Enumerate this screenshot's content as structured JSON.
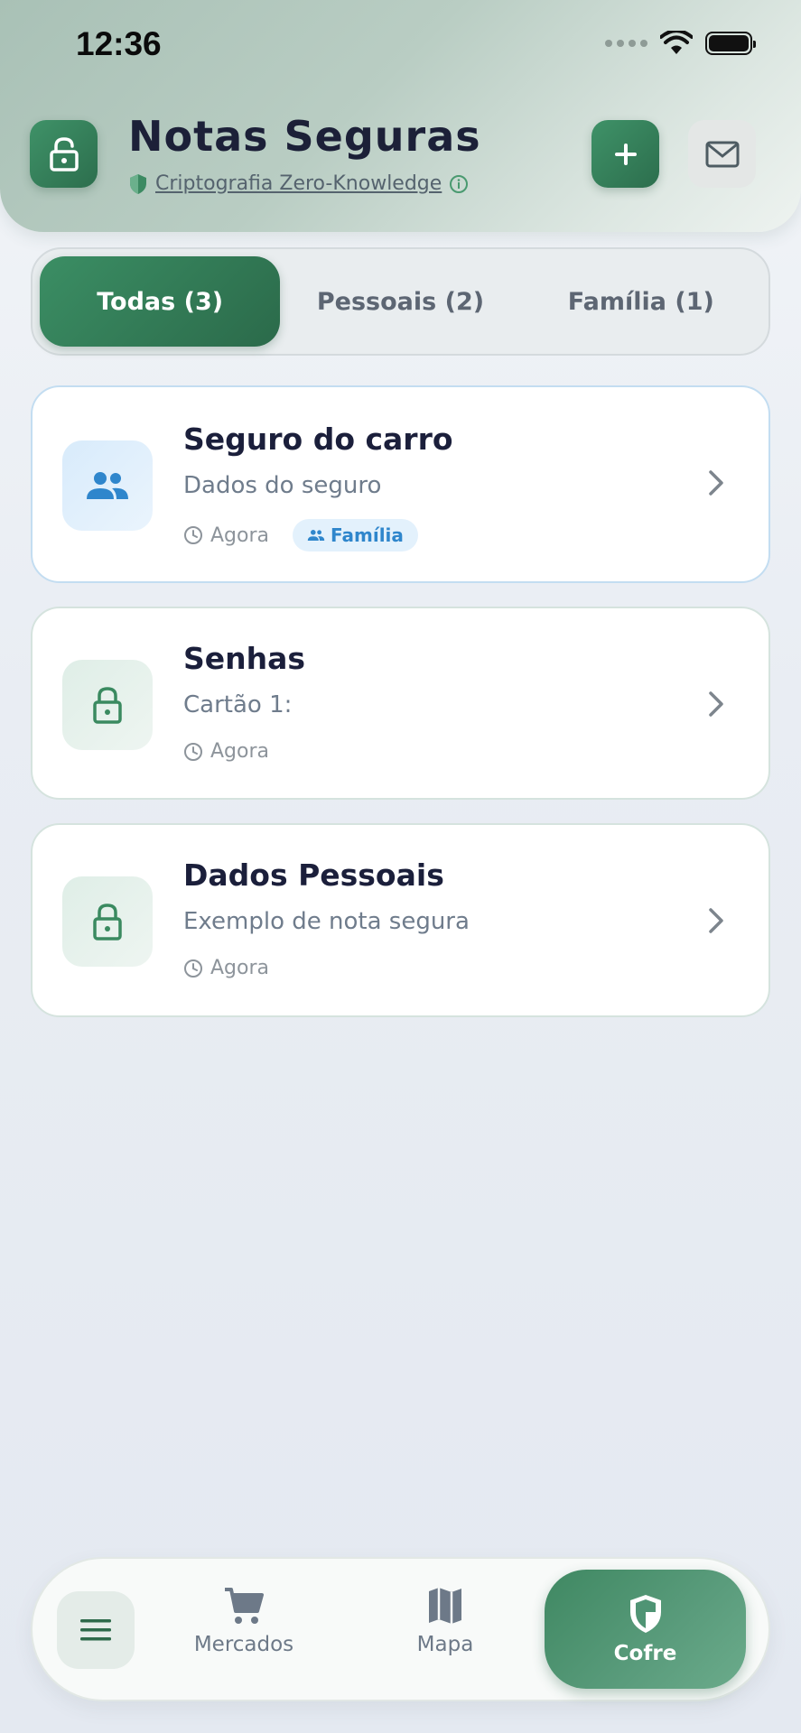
{
  "status_bar": {
    "time": "12:36"
  },
  "header": {
    "title": "Notas Seguras",
    "subtitle": "Criptografia Zero-Knowledge"
  },
  "tabs": [
    {
      "label": "Todas (3)",
      "active": true
    },
    {
      "label": "Pessoais (2)",
      "active": false
    },
    {
      "label": "Família (1)",
      "active": false
    }
  ],
  "notes": [
    {
      "title": "Seguro do carro",
      "description": "Dados do seguro",
      "time": "Agora",
      "tag": "Família",
      "icon": "people-icon"
    },
    {
      "title": "Senhas",
      "description": "Cartão 1:",
      "time": "Agora",
      "tag": "",
      "icon": "lock-icon"
    },
    {
      "title": "Dados Pessoais",
      "description": "Exemplo de nota segura",
      "time": "Agora",
      "tag": "",
      "icon": "lock-icon"
    }
  ],
  "bottom_nav": {
    "items": [
      {
        "label": "Mercados",
        "icon": "cart-icon"
      },
      {
        "label": "Mapa",
        "icon": "map-icon"
      },
      {
        "label": "Cofre",
        "icon": "shield-icon",
        "active": true
      }
    ]
  },
  "colors": {
    "primary_green": "#2c6e4d",
    "family_blue": "#2f86cc",
    "title_text": "#1b1f3b"
  }
}
